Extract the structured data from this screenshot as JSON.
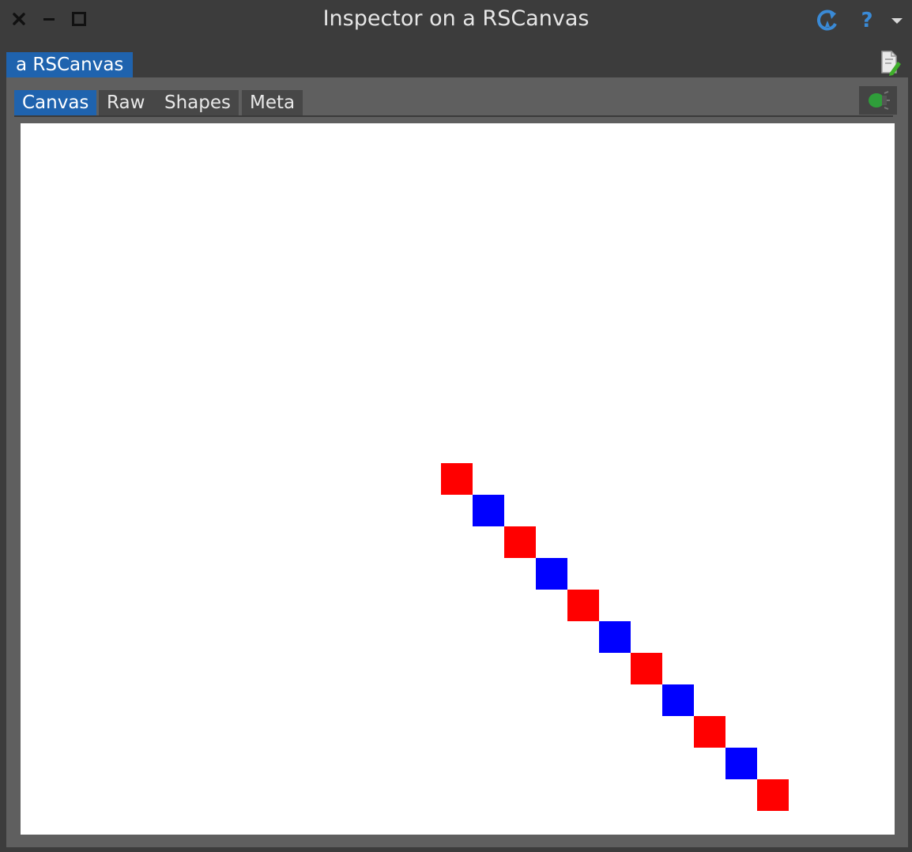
{
  "window": {
    "title": "Inspector on a RSCanvas",
    "close_icon": "close-icon",
    "minimize_icon": "minimize-icon",
    "maximize_icon": "maximize-icon",
    "refresh_icon": "refresh-icon",
    "help_label": "?",
    "menu_icon": "chevron-down-icon"
  },
  "object_tab": {
    "label": "a RSCanvas"
  },
  "tabs": [
    {
      "label": "Canvas",
      "active": true
    },
    {
      "label": "Raw",
      "active": false
    },
    {
      "label": "Shapes",
      "active": false
    },
    {
      "label": "Meta",
      "active": false
    }
  ],
  "colors": {
    "accent": "#1f63ae",
    "background": "#3c3c3c",
    "panel": "#5f5f5f",
    "shape_red": "#ff0000",
    "shape_blue": "#0000ff"
  },
  "canvas": {
    "shape_count": 11,
    "shape_colors": [
      "red",
      "blue",
      "red",
      "blue",
      "red",
      "blue",
      "red",
      "blue",
      "red",
      "blue",
      "red"
    ]
  }
}
